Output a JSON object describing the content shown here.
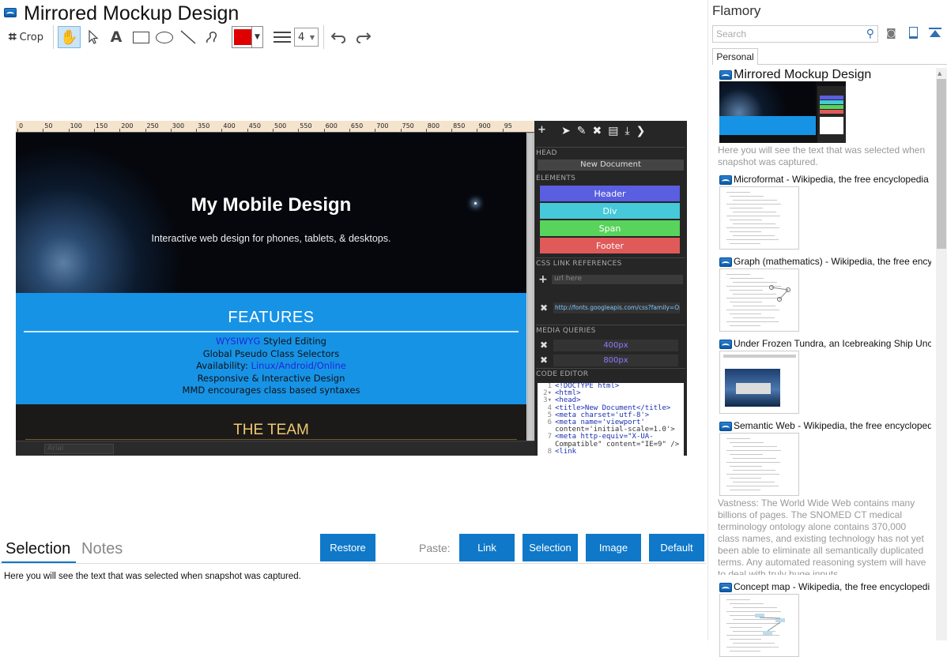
{
  "window": {
    "title": "Mirrored Mockup Design"
  },
  "toolbar": {
    "crop_label": "Crop",
    "text_tool": "A",
    "line_width_value": "4",
    "color_swatch": "#e00000"
  },
  "screenshot": {
    "ruler_ticks": [
      "0",
      "50",
      "100",
      "150",
      "200",
      "250",
      "300",
      "350",
      "400",
      "450",
      "500",
      "550",
      "600",
      "650",
      "700",
      "750",
      "800",
      "850",
      "900",
      "95"
    ],
    "hero_title": "My Mobile Design",
    "hero_subtitle": "Interactive web design for phones, tablets, & desktops.",
    "features_heading": "FEATURES",
    "feature_lines": [
      {
        "a": "WYSIWYG",
        "b": " Styled Editing"
      },
      {
        "a": "",
        "b": "Global Pseudo Class Selectors"
      },
      {
        "a": "Availability: ",
        "b": "Linux/Android/Online"
      },
      {
        "a": "",
        "b": "Responsive & Interactive Design"
      },
      {
        "a": "MMD encourages class based ",
        "b": "syntaxes"
      }
    ],
    "team_heading": "THE TEAM",
    "editor": {
      "head_label": "HEAD",
      "doc_title": "New Document",
      "elements_label": "ELEMENTS",
      "elements": [
        {
          "label": "Header",
          "color": "#5a5ee0"
        },
        {
          "label": "Div",
          "color": "#46c9d9"
        },
        {
          "label": "Span",
          "color": "#58d35c"
        },
        {
          "label": "Footer",
          "color": "#e05a5a"
        }
      ],
      "css_label": "CSS LINK REFERENCES",
      "url_placeholder": "url here",
      "css_url": "http://fonts.googleapis.com/css?family=Oper",
      "media_label": "MEDIA QUERIES",
      "media": [
        "400px",
        "800px"
      ],
      "code_label": "CODE EDITOR",
      "code_lines": [
        {
          "n": "1",
          "t": "<!DOCTYPE html>"
        },
        {
          "n": "2▾",
          "t": "<html>"
        },
        {
          "n": "3▾",
          "t": "<head>"
        },
        {
          "n": "4",
          "t": "<title>New Document</title>"
        },
        {
          "n": "5",
          "t": "<meta charset='utf-8'>"
        },
        {
          "n": "6",
          "t": "<meta name='viewport'"
        },
        {
          "n": "",
          "t": "content='initial-scale=1.0'>"
        },
        {
          "n": "7",
          "t": "<meta http-equiv=\"X-UA-"
        },
        {
          "n": "",
          "t": "Compatible\" content=\"IE=9\" />"
        },
        {
          "n": "8",
          "t": "<link"
        }
      ]
    },
    "bottom_font": "Arial"
  },
  "bottom": {
    "tab_selection": "Selection",
    "tab_notes": "Notes",
    "restore_label": "Restore",
    "paste_label": "Paste:",
    "paste_buttons": [
      "Link",
      "Selection",
      "Image",
      "Default"
    ],
    "selection_text": "Here you will see the text that was selected when snapshot was captured."
  },
  "sidebar": {
    "app_title": "Flamory",
    "search_placeholder": "Search",
    "tab_personal": "Personal",
    "snapshots": [
      {
        "title": "Mirrored Mockup Design",
        "desc": "Here you will see the text that was selected when snapshot was captured."
      },
      {
        "title": "Microformat - Wikipedia, the free encyclopedia",
        "desc": ""
      },
      {
        "title": "Graph (mathematics) - Wikipedia, the free encyc",
        "desc": ""
      },
      {
        "title": "Under Frozen Tundra, an Icebreaking Ship Unco",
        "desc": ""
      },
      {
        "title": "Semantic Web - Wikipedia, the free encycloped",
        "desc": "Vastness: The World Wide Web contains many billions of pages. The SNOMED CT medical terminology ontology alone contains 370,000 class names, and existing technology has not yet been able to eliminate all semantically duplicated terms. Any automated reasoning system will have to deal with truly huge inputs."
      },
      {
        "title": "Concept map - Wikipedia, the free encyclopedi",
        "desc": ""
      }
    ]
  }
}
